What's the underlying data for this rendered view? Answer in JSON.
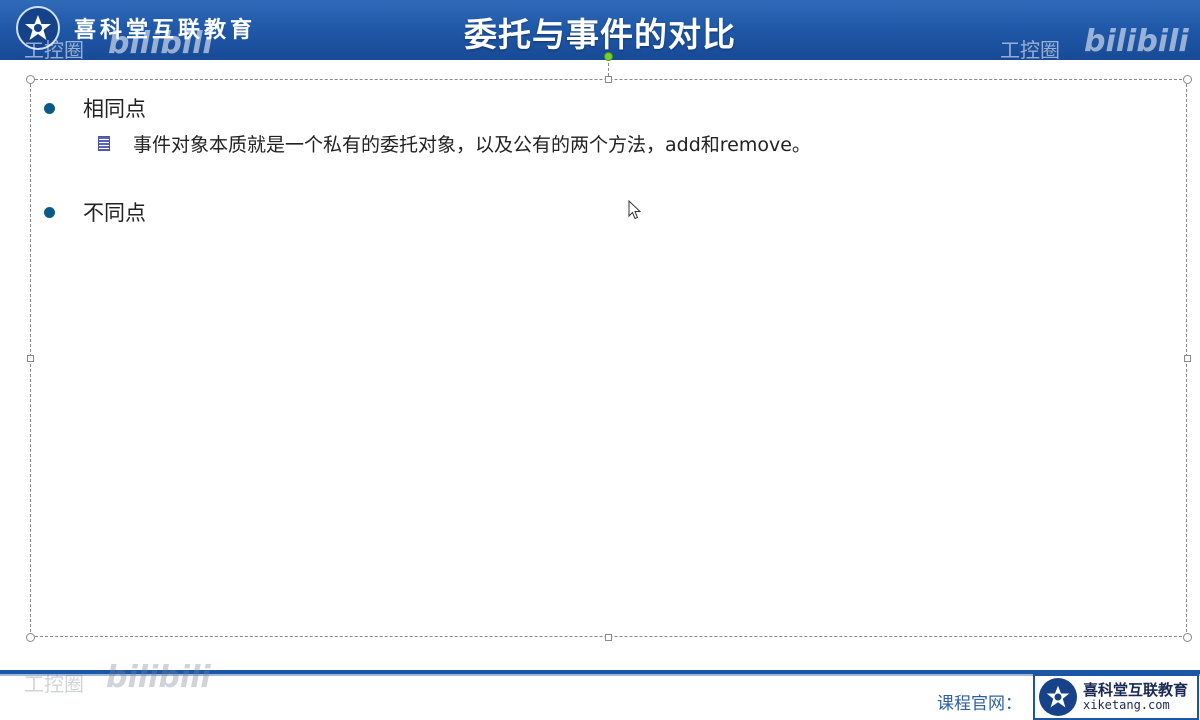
{
  "header": {
    "org_name": "喜科堂互联教育",
    "slide_title": "委托与事件的对比",
    "watermark_text": "工控圈",
    "watermark_bili": "bilibili"
  },
  "content": {
    "bullets": [
      {
        "label": "相同点",
        "sub_items": [
          "事件对象本质就是一个私有的委托对象，以及公有的两个方法，add和remove。"
        ]
      },
      {
        "label": "不同点",
        "sub_items": []
      }
    ]
  },
  "footer": {
    "course_site_label": "课程官网：",
    "logo_name": "喜科堂互联教育",
    "logo_url": "xiketang.com"
  },
  "colors": {
    "header_blue": "#1e56a6",
    "bullet_dot": "#0d5a86",
    "rotation_handle": "#7ccd2e"
  },
  "icons": [
    "star-logo-icon",
    "bullet-dot-icon",
    "sub-bullet-icon",
    "mouse-cursor-icon"
  ]
}
